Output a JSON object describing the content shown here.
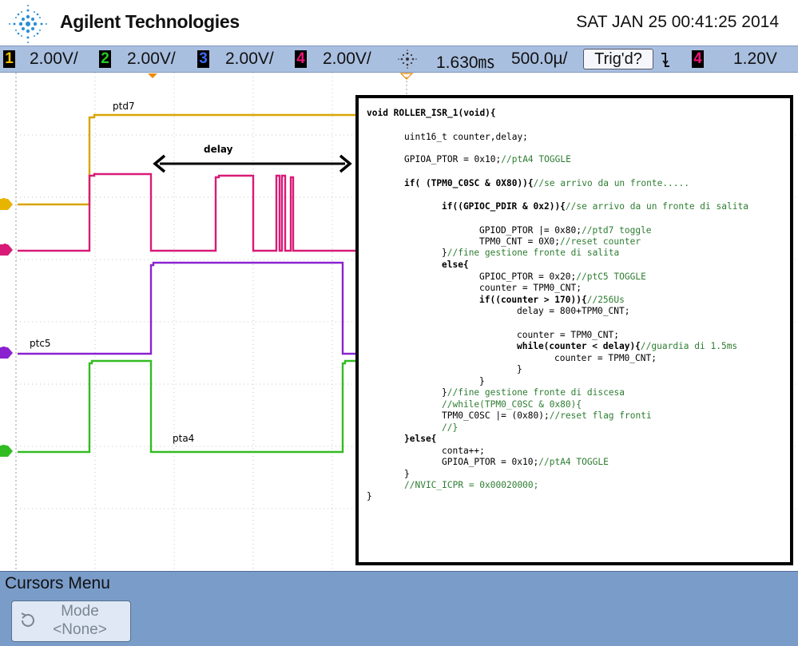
{
  "header": {
    "brand": "Agilent Technologies",
    "datetime": "SAT JAN 25 00:41:25 2014"
  },
  "statusbar": {
    "channels": [
      {
        "num": "1",
        "scale": "2.00V/",
        "color": "#f5c000"
      },
      {
        "num": "2",
        "scale": "2.00V/",
        "color": "#22cc22"
      },
      {
        "num": "3",
        "scale": "2.00V/",
        "color": "#3b6cf0"
      },
      {
        "num": "4",
        "scale": "2.00V/",
        "color": "#ee1477"
      }
    ],
    "time_position": "1.630㎳",
    "time_scale": "500.0µ/",
    "trigger_state": "Trig'd?",
    "trigger_source": "4",
    "trigger_level": "1.20V"
  },
  "screen": {
    "signals": [
      {
        "label": "ptd7",
        "channel": "1",
        "color": "#d9a400"
      },
      {
        "label": "ptc5",
        "channel": "3",
        "color": "#8a22d0"
      },
      {
        "label": "pta4",
        "channel": "2",
        "color": "#33bb22"
      }
    ],
    "marker_4": "4",
    "arrow_label": "delay",
    "ch_markers": [
      "1",
      "4",
      "3",
      "2"
    ]
  },
  "code": {
    "lines": [
      {
        "t": "void ROLLER_ISR_1(void){",
        "k": true,
        "i": 0
      },
      {
        "t": "uint16_t counter,delay;",
        "k": false,
        "i": 1
      },
      {
        "t": "GPIOA_PTOR = 0x10;",
        "c": "//ptA4 TOGGLE",
        "i": 1
      },
      {
        "t": "if( (TPM0_C0SC & 0X80)){",
        "c": "//se arrivo da un fronte.....",
        "i": 1,
        "k": true
      },
      {
        "t": "if((GPIOC_PDIR & 0x2)){",
        "c": "//se arrivo da un fronte di salita",
        "i": 2,
        "k": true
      },
      {
        "t": "GPIOD_PTOR |= 0x80;",
        "c": "//ptd7 toggle",
        "i": 3
      },
      {
        "t": "TPM0_CNT = 0X0;",
        "c": "//reset counter",
        "i": 3
      },
      {
        "t": "}",
        "c": "//fine gestione fronte di salita",
        "i": 2
      },
      {
        "t": "else{",
        "i": 2,
        "k": true
      },
      {
        "t": "GPIOC_PTOR = 0x20;",
        "c": "//ptC5 TOGGLE",
        "i": 3
      },
      {
        "t": "counter = TPM0_CNT;",
        "i": 3
      },
      {
        "t": "if((counter > 170)){",
        "c": "//256Us",
        "i": 3,
        "k": true
      },
      {
        "t": "delay = 800+TPM0_CNT;",
        "i": 4
      },
      {
        "t": "counter = TPM0_CNT;",
        "i": 4
      },
      {
        "t": "while(counter < delay){",
        "c": "//guardia di 1.5ms",
        "i": 4,
        "k": true
      },
      {
        "t": "counter = TPM0_CNT;",
        "i": 5
      },
      {
        "t": "}",
        "i": 4
      },
      {
        "t": "}",
        "i": 3
      },
      {
        "t": "}",
        "c": "//fine gestione fronte di discesa",
        "i": 2
      },
      {
        "t": "",
        "c": "//while(TPM0_C0SC & 0x80){",
        "i": 2
      },
      {
        "t": "TPM0_C0SC |= (0x80);",
        "c": "//reset flag fronti",
        "i": 2
      },
      {
        "t": "",
        "c": "//}",
        "i": 2
      },
      {
        "t": "}else{",
        "i": 1,
        "k": true
      },
      {
        "t": "conta++;",
        "i": 2
      },
      {
        "t": "GPIOA_PTOR = 0x10;",
        "c": "//ptA4 TOGGLE",
        "i": 2
      },
      {
        "t": "}",
        "i": 1
      },
      {
        "t": "",
        "c": "//NVIC_ICPR = 0x00020000;",
        "i": 1
      },
      {
        "t": "}",
        "i": 0
      }
    ]
  },
  "menu": {
    "title": "Cursors Menu",
    "mode_label": "Mode",
    "mode_value": "<None>"
  }
}
